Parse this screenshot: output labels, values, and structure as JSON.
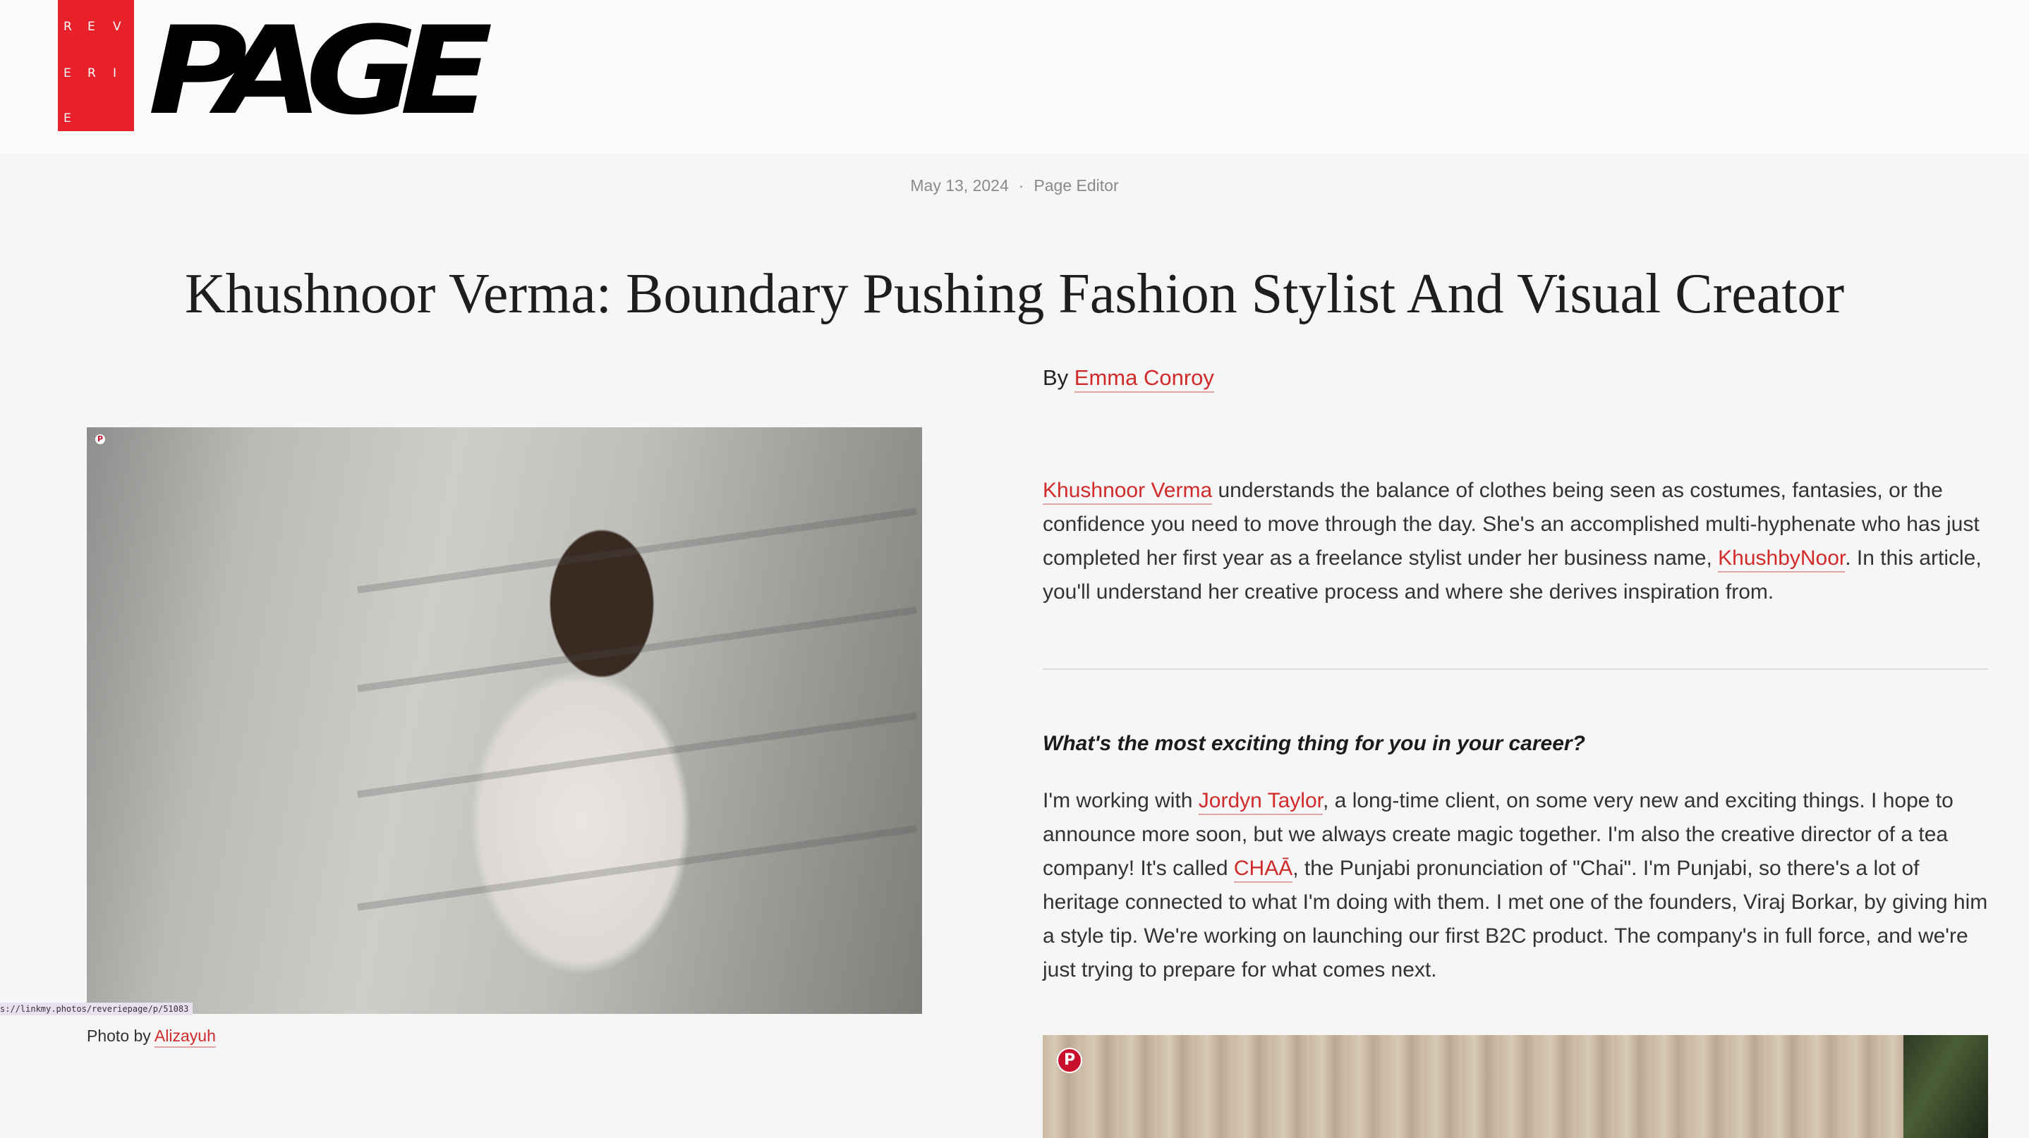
{
  "logo": {
    "box_letters": [
      "R",
      "E",
      "V",
      "E",
      "R",
      "I",
      "E"
    ],
    "word": "PAGE"
  },
  "meta": {
    "date": "May 13, 2024",
    "separator": "·",
    "author": "Page Editor"
  },
  "article": {
    "title": "Khushnoor Verma: Boundary Pushing Fashion Stylist And Visual Creator",
    "byline_prefix": "By ",
    "byline_name": "Emma Conroy",
    "intro": {
      "link1": "Khushnoor Verma",
      "text1": " understands the balance of clothes being seen as costumes, fantasies, or the confidence you need to move through the day. She's an accomplished multi-hyphenate who has just completed her first year as a freelance stylist under her business name, ",
      "link2": "KhushbyNoor",
      "text2": ". In this article, you'll understand her creative process and where she derives inspiration from."
    },
    "question": "What's the most exciting thing for you in your career?",
    "answer": {
      "text1": "I'm working with ",
      "link1": "Jordyn Taylor",
      "text2": ", a long-time client, on some very new and exciting things. I hope to announce more soon, but we always create magic together. I'm also the creative director of a tea company! It's called ",
      "link2": "CHAĀ",
      "text3": ", the Punjabi pronunciation of \"Chai\". I'm Punjabi, so there's a lot of heritage connected to what I'm doing with them. I met one of the founders, Viraj Borkar, by giving him a style tip. We're working on launching our first B2C product. The company's in full force, and we're just trying to prepare for what comes next."
    }
  },
  "photo": {
    "caption_prefix": "Photo by ",
    "caption_credit": "Alizayuh",
    "url_badge": "s://linkmy.photos/reveriepage/p/51083"
  },
  "icons": {
    "pinterest": "pinterest-icon"
  },
  "colors": {
    "brand_red": "#e8202a",
    "link_red": "#d12a2a"
  }
}
